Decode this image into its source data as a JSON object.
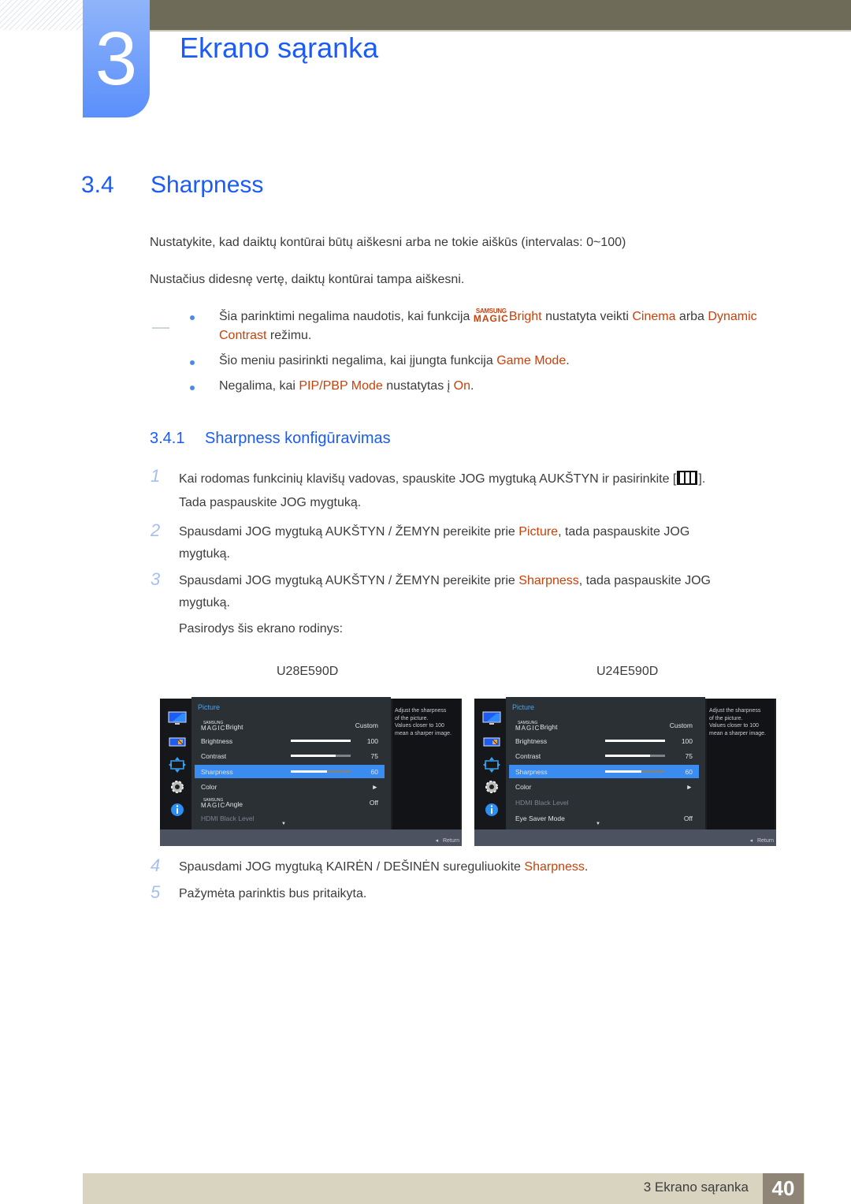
{
  "chapter": {
    "number": "3",
    "title": "Ekrano sąranka"
  },
  "section": {
    "number": "3.4",
    "title": "Sharpness"
  },
  "intro": [
    "Nustatykite, kad daiktų kontūrai būtų aiškesni arba ne tokie aiškūs (intervalas: 0~100)",
    "Nustačius didesnę vertę, daiktų kontūrai tampa aiškesni."
  ],
  "notes": {
    "n1": {
      "a": "Šia parinktimi negalima naudotis, kai funkcija ",
      "magic_top": "SAMSUNG",
      "magic_bottom": "MAGIC",
      "b": "Bright",
      "c": " nustatyta veikti ",
      "d": "Cinema",
      "e": " arba ",
      "f": "Dynamic",
      "g": "Contrast",
      "h": " režimu."
    },
    "n2": {
      "a": "Šio meniu pasirinkti negalima, kai įjungta funkcija ",
      "b": "Game Mode",
      "c": "."
    },
    "n3": {
      "a": "Negalima, kai ",
      "b": "PIP/PBP Mode",
      "c": " nustatytas į ",
      "d": "On",
      "e": "."
    }
  },
  "subsection": {
    "number": "3.4.1",
    "title": "Sharpness konfigūravimas"
  },
  "steps": {
    "s1": {
      "num": "1",
      "a": "Kai rodomas funkcinių klavišų vadovas, spauskite JOG mygtuką AUKŠTYN ir pasirinkite [",
      "b": "].",
      "line2": "Tada paspauskite JOG mygtuką."
    },
    "s2": {
      "num": "2",
      "a": "Spausdami JOG mygtuką AUKŠTYN / ŽEMYN pereikite prie ",
      "b": "Picture",
      "c": ", tada paspauskite JOG",
      "line2": "mygtuką."
    },
    "s3": {
      "num": "3",
      "a": "Spausdami JOG mygtuką AUKŠTYN / ŽEMYN pereikite prie ",
      "b": "Sharpness",
      "c": ", tada paspauskite JOG",
      "line2": "mygtuką.",
      "line3": "Pasirodys šis ekrano rodinys:"
    },
    "s4": {
      "num": "4",
      "a": "Spausdami JOG mygtuką KAIRĖN / DEŠINĖN sureguliuokite ",
      "b": "Sharpness",
      "c": "."
    },
    "s5": {
      "num": "5",
      "a": "Pažymėta parinktis bus pritaikyta."
    }
  },
  "osd_left": {
    "model": "U28E590D",
    "header": "Picture",
    "help": [
      "Adjust the sharpness",
      "of the picture.",
      "Values closer to 100",
      "mean a sharper image."
    ],
    "return": "Return",
    "magic_top": "SAMSUNG",
    "magic_bottom": "MAGIC",
    "rows": {
      "r0": {
        "label": "Bright",
        "value": "Custom"
      },
      "r1": {
        "label": "Brightness",
        "value": "100",
        "level": 100
      },
      "r2": {
        "label": "Contrast",
        "value": "75",
        "level": 75
      },
      "r3": {
        "label": "Sharpness",
        "value": "60",
        "level": 60
      },
      "r4": {
        "label": "Color",
        "value": "►"
      },
      "r5": {
        "label": "Angle",
        "value": "Off"
      },
      "r6": {
        "label": "HDMI Black Level",
        "value": ""
      }
    }
  },
  "osd_right": {
    "model": "U24E590D",
    "header": "Picture",
    "help": [
      "Adjust the sharpness",
      "of the picture.",
      "Values closer to 100",
      "mean a sharper image."
    ],
    "return": "Return",
    "magic_top": "SAMSUNG",
    "magic_bottom": "MAGIC",
    "rows": {
      "r0": {
        "label": "Bright",
        "value": "Custom"
      },
      "r1": {
        "label": "Brightness",
        "value": "100",
        "level": 100
      },
      "r2": {
        "label": "Contrast",
        "value": "75",
        "level": 75
      },
      "r3": {
        "label": "Sharpness",
        "value": "60",
        "level": 60
      },
      "r4": {
        "label": "Color",
        "value": "►"
      },
      "r5": {
        "label": "HDMI Black Level",
        "value": ""
      },
      "r6": {
        "label": "Eye Saver Mode",
        "value": "Off"
      }
    }
  },
  "footer": {
    "text": "3 Ekrano sąranka",
    "page": "40"
  },
  "colors": {
    "accent_blue": "#1a5cf5",
    "highlight_orange": "#c8410a",
    "osd_select": "#3a8cf0"
  }
}
